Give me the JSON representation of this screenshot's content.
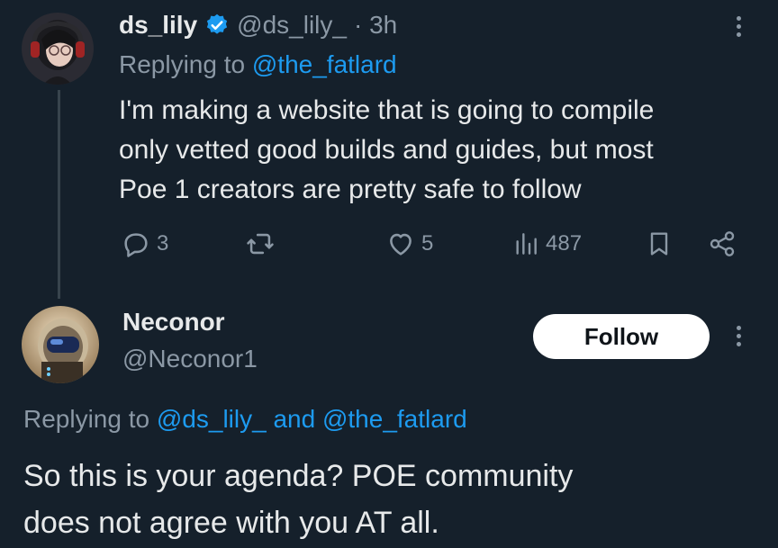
{
  "tweet1": {
    "name": "ds_lily",
    "handle": "@ds_lily_",
    "time": "· 3h",
    "replying_prefix": "Replying to",
    "replying_to": "@the_fatlard",
    "body_lines": [
      "I'm making a website that is going to compile",
      "only vetted good builds and guides, but most",
      "Poe 1 creators are pretty safe to follow"
    ],
    "replies": "3",
    "likes": "5",
    "views": "487",
    "icons": [
      "reply-icon",
      "retweet-icon",
      "like-icon",
      "views-icon",
      "bookmark-icon",
      "share-icon",
      "more-icon",
      "verified-badge-icon"
    ]
  },
  "tweet2": {
    "name": "Neconor",
    "handle": "@Neconor1",
    "follow_label": "Follow",
    "replying_prefix": "Replying to",
    "replying_to_1": "@ds_lily_",
    "and_word": "and",
    "replying_to_2": "@the_fatlard",
    "body_lines": [
      "So this is your agenda? POE community",
      "does not agree with you AT all."
    ]
  },
  "colors": {
    "background": "#15202b",
    "text": "#e7e9ea",
    "muted": "#8b98a5",
    "link": "#1d9bf0",
    "verified": "#1d9bf0"
  }
}
